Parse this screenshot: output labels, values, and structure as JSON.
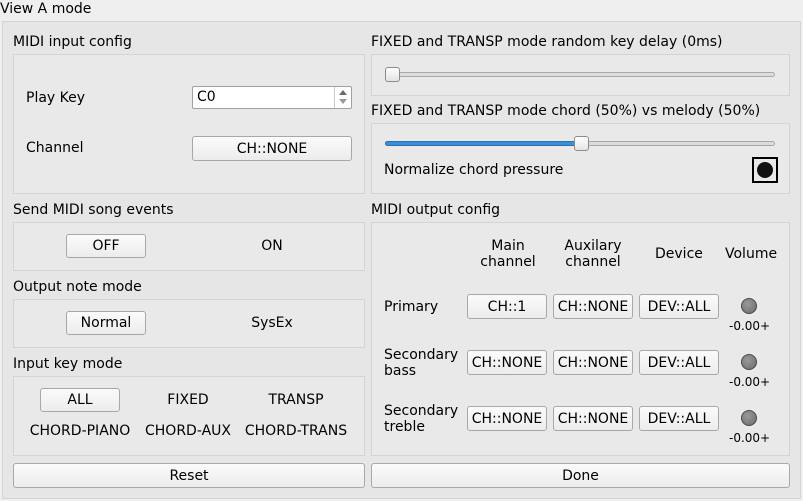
{
  "window_title": "View A mode",
  "midi_input": {
    "title": "MIDI input config",
    "play_key_label": "Play Key",
    "play_key_value": "C0",
    "channel_label": "Channel",
    "channel_value": "CH::NONE"
  },
  "song_events": {
    "title": "Send MIDI song events",
    "off": "OFF",
    "on": "ON",
    "selected": "OFF"
  },
  "output_note": {
    "title": "Output note mode",
    "normal": "Normal",
    "sysex": "SysEx",
    "selected": "Normal"
  },
  "input_key": {
    "title": "Input key mode",
    "options": [
      "ALL",
      "FIXED",
      "TRANSP",
      "CHORD-PIANO",
      "CHORD-AUX",
      "CHORD-TRANS"
    ],
    "selected": "ALL"
  },
  "delay": {
    "title": "FIXED and TRANSP mode random key delay (0ms)",
    "value_ms": 0
  },
  "chord": {
    "title": "FIXED and TRANSP mode chord (50%) vs melody (50%)",
    "value_percent": 50,
    "normalize_label": "Normalize chord pressure",
    "normalize_checked": true
  },
  "midi_output": {
    "title": "MIDI output config",
    "headers": {
      "main": "Main channel",
      "aux": "Auxilary channel",
      "device": "Device",
      "volume": "Volume"
    },
    "rows": [
      {
        "label": "Primary",
        "main": "CH::1",
        "aux": "CH::NONE",
        "device": "DEV::ALL",
        "volume": "-0.00+"
      },
      {
        "label": "Secondary bass",
        "main": "CH::NONE",
        "aux": "CH::NONE",
        "device": "DEV::ALL",
        "volume": "-0.00+"
      },
      {
        "label": "Secondary treble",
        "main": "CH::NONE",
        "aux": "CH::NONE",
        "device": "DEV::ALL",
        "volume": "-0.00+"
      }
    ]
  },
  "buttons": {
    "reset": "Reset",
    "done": "Done"
  }
}
